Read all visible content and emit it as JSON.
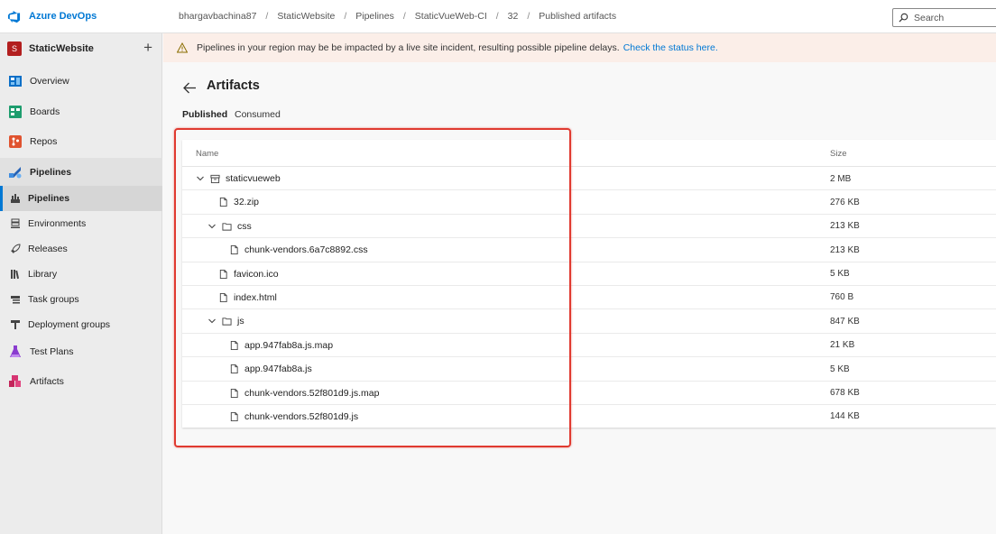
{
  "app": {
    "brand": "Azure DevOps"
  },
  "breadcrumb": [
    "bhargavbachina87",
    "StaticWebsite",
    "Pipelines",
    "StaticVueWeb-CI",
    "32",
    "Published artifacts"
  ],
  "search": {
    "label": "Search"
  },
  "sidebar": {
    "project": {
      "avatar": "S",
      "name": "StaticWebsite",
      "add": "+"
    },
    "items": [
      {
        "label": "Overview",
        "icon": "overview-icon"
      },
      {
        "label": "Boards",
        "icon": "boards-icon"
      },
      {
        "label": "Repos",
        "icon": "repos-icon"
      },
      {
        "label": "Pipelines",
        "icon": "pipelines-icon"
      },
      {
        "label": "Pipelines",
        "icon": "pipelines-sub-icon"
      },
      {
        "label": "Environments",
        "icon": "environments-icon"
      },
      {
        "label": "Releases",
        "icon": "releases-icon"
      },
      {
        "label": "Library",
        "icon": "library-icon"
      },
      {
        "label": "Task groups",
        "icon": "task-groups-icon"
      },
      {
        "label": "Deployment groups",
        "icon": "deployment-groups-icon"
      },
      {
        "label": "Test Plans",
        "icon": "test-plans-icon"
      },
      {
        "label": "Artifacts",
        "icon": "artifacts-icon"
      }
    ]
  },
  "banner": {
    "text": "Pipelines in your region may be be impacted by a live site incident, resulting possible pipeline delays.",
    "link": "Check the status here."
  },
  "page": {
    "title": "Artifacts",
    "tabs": [
      "Published",
      "Consumed"
    ]
  },
  "table": {
    "columns": {
      "name": "Name",
      "size": "Size"
    },
    "rows": [
      {
        "name": "staticvueweb",
        "size": "2 MB",
        "type": "artifact",
        "expanded": true
      },
      {
        "name": "32.zip",
        "size": "276 KB",
        "type": "file"
      },
      {
        "name": "css",
        "size": "213 KB",
        "type": "folder",
        "expanded": true
      },
      {
        "name": "chunk-vendors.6a7c8892.css",
        "size": "213 KB",
        "type": "file"
      },
      {
        "name": "favicon.ico",
        "size": "5 KB",
        "type": "file"
      },
      {
        "name": "index.html",
        "size": "760 B",
        "type": "file"
      },
      {
        "name": "js",
        "size": "847 KB",
        "type": "folder",
        "expanded": true
      },
      {
        "name": "app.947fab8a.js.map",
        "size": "21 KB",
        "type": "file"
      },
      {
        "name": "app.947fab8a.js",
        "size": "5 KB",
        "type": "file"
      },
      {
        "name": "chunk-vendors.52f801d9.js.map",
        "size": "678 KB",
        "type": "file"
      },
      {
        "name": "chunk-vendors.52f801d9.js",
        "size": "144 KB",
        "type": "file"
      }
    ]
  },
  "colors": {
    "accent": "#0078d4",
    "highlight": "#e03a30",
    "banner_bg": "#fbeee8"
  }
}
